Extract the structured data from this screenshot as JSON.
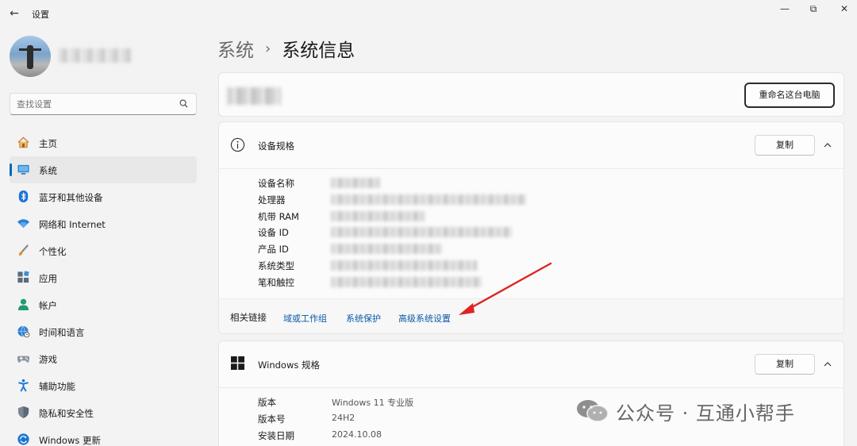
{
  "window": {
    "back_glyph": "←",
    "app_title": "设置",
    "minimize_glyph": "—",
    "maximize_glyph": "⧉",
    "close_glyph": "✕"
  },
  "search": {
    "placeholder": "查找设置",
    "value": ""
  },
  "sidebar": {
    "items": [
      {
        "label": "主页",
        "icon": "home-icon",
        "active": false
      },
      {
        "label": "系统",
        "icon": "system-icon",
        "active": true
      },
      {
        "label": "蓝牙和其他设备",
        "icon": "bluetooth-icon",
        "active": false
      },
      {
        "label": "网络和 Internet",
        "icon": "wifi-icon",
        "active": false
      },
      {
        "label": "个性化",
        "icon": "brush-icon",
        "active": false
      },
      {
        "label": "应用",
        "icon": "apps-icon",
        "active": false
      },
      {
        "label": "帐户",
        "icon": "account-icon",
        "active": false
      },
      {
        "label": "时间和语言",
        "icon": "globe-icon",
        "active": false
      },
      {
        "label": "游戏",
        "icon": "gamepad-icon",
        "active": false
      },
      {
        "label": "辅助功能",
        "icon": "accessibility-icon",
        "active": false
      },
      {
        "label": "隐私和安全性",
        "icon": "shield-icon",
        "active": false
      },
      {
        "label": "Windows 更新",
        "icon": "windows-update-icon",
        "active": false
      }
    ]
  },
  "breadcrumb": {
    "parent": "系统",
    "separator": "›",
    "current": "系统信息"
  },
  "pc_card": {
    "rename_label": "重命名这台电脑"
  },
  "device_specs": {
    "title": "设备规格",
    "copy_label": "复制",
    "rows": [
      {
        "label": "设备名称"
      },
      {
        "label": "处理器"
      },
      {
        "label": "机带 RAM"
      },
      {
        "label": "设备 ID"
      },
      {
        "label": "产品 ID"
      },
      {
        "label": "系统类型"
      },
      {
        "label": "笔和触控"
      }
    ]
  },
  "related_links": {
    "label": "相关链接",
    "links": [
      "域或工作组",
      "系统保护",
      "高级系统设置"
    ]
  },
  "windows_specs": {
    "title": "Windows 规格",
    "copy_label": "复制",
    "rows": [
      {
        "label": "版本",
        "value": "Windows 11 专业版"
      },
      {
        "label": "版本号",
        "value": "24H2"
      },
      {
        "label": "安装日期",
        "value": "2024.10.08"
      }
    ]
  },
  "watermark": {
    "text": "公众号 · 互通小帮手"
  },
  "colors": {
    "accent": "#0067c0",
    "link": "#0a5aa8",
    "annotation_arrow": "#e02424",
    "background": "#f3f3f3"
  }
}
